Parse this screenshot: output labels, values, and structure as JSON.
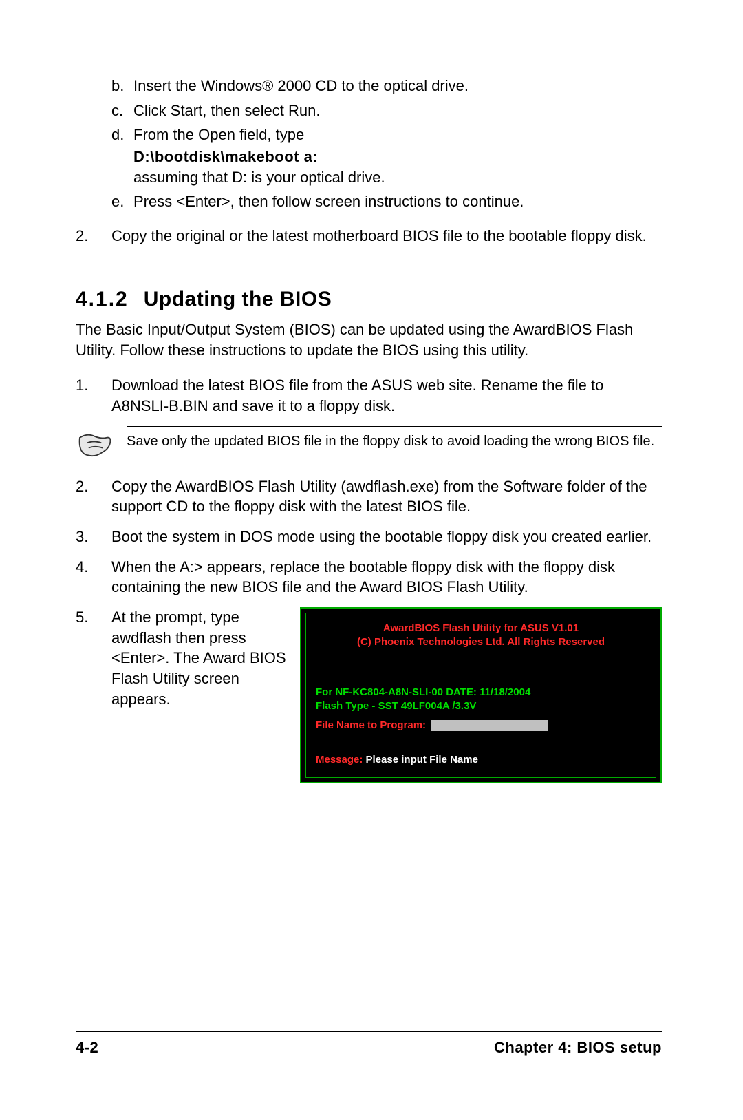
{
  "top_list": {
    "b": {
      "marker": "b.",
      "text": "Insert the Windows® 2000 CD to the optical drive."
    },
    "c": {
      "marker": "c.",
      "text": "Click Start, then select Run."
    },
    "d": {
      "marker": "d.",
      "text": "From the Open field, type",
      "cmd": "D:\\bootdisk\\makeboot a:",
      "after": "assuming that D: is your optical drive."
    },
    "e": {
      "marker": "e.",
      "text": "Press <Enter>, then follow screen instructions to continue."
    }
  },
  "step2_top": {
    "marker": "2.",
    "text": "Copy the original or the latest motherboard BIOS file to the bootable floppy disk."
  },
  "heading": {
    "num": "4.1.2",
    "title": "Updating the BIOS"
  },
  "intro": "The Basic Input/Output System (BIOS) can be updated using the AwardBIOS Flash Utility. Follow these instructions to update the BIOS using this utility.",
  "steps": {
    "s1": {
      "marker": "1.",
      "text": "Download the latest BIOS file from the ASUS web site. Rename the file to A8NSLI-B.BIN and save it to a floppy disk."
    },
    "s2": {
      "marker": "2.",
      "text": "Copy the AwardBIOS Flash Utility (awdflash.exe) from the Software folder of the support CD to the floppy disk with the latest BIOS file."
    },
    "s3": {
      "marker": "3.",
      "text": "Boot the system in DOS mode using the bootable floppy disk you created earlier."
    },
    "s4": {
      "marker": "4.",
      "text": "When the A:> appears, replace the bootable floppy disk with the floppy disk containing the new BIOS file and the Award BIOS Flash Utility."
    },
    "s5": {
      "marker": "5.",
      "text": "At the prompt, type awdflash then press <Enter>. The Award BIOS Flash Utility screen appears."
    }
  },
  "note": "Save only the updated BIOS file in the floppy disk to avoid loading the wrong BIOS file.",
  "terminal": {
    "title_line": "AwardBIOS Flash Utility for ASUS V1.01",
    "copyright_line": "(C) Phoenix Technologies Ltd. All Rights Reserved",
    "info1": "For NF-KC804-A8N-SLI-00       DATE: 11/18/2004",
    "info2": "Flash Type - SST 49LF004A /3.3V",
    "prompt_label": "File Name to Program:",
    "message_label": "Message:",
    "message_text": "Please input File Name"
  },
  "footer": {
    "left": "4-2",
    "right": "Chapter 4: BIOS setup"
  }
}
